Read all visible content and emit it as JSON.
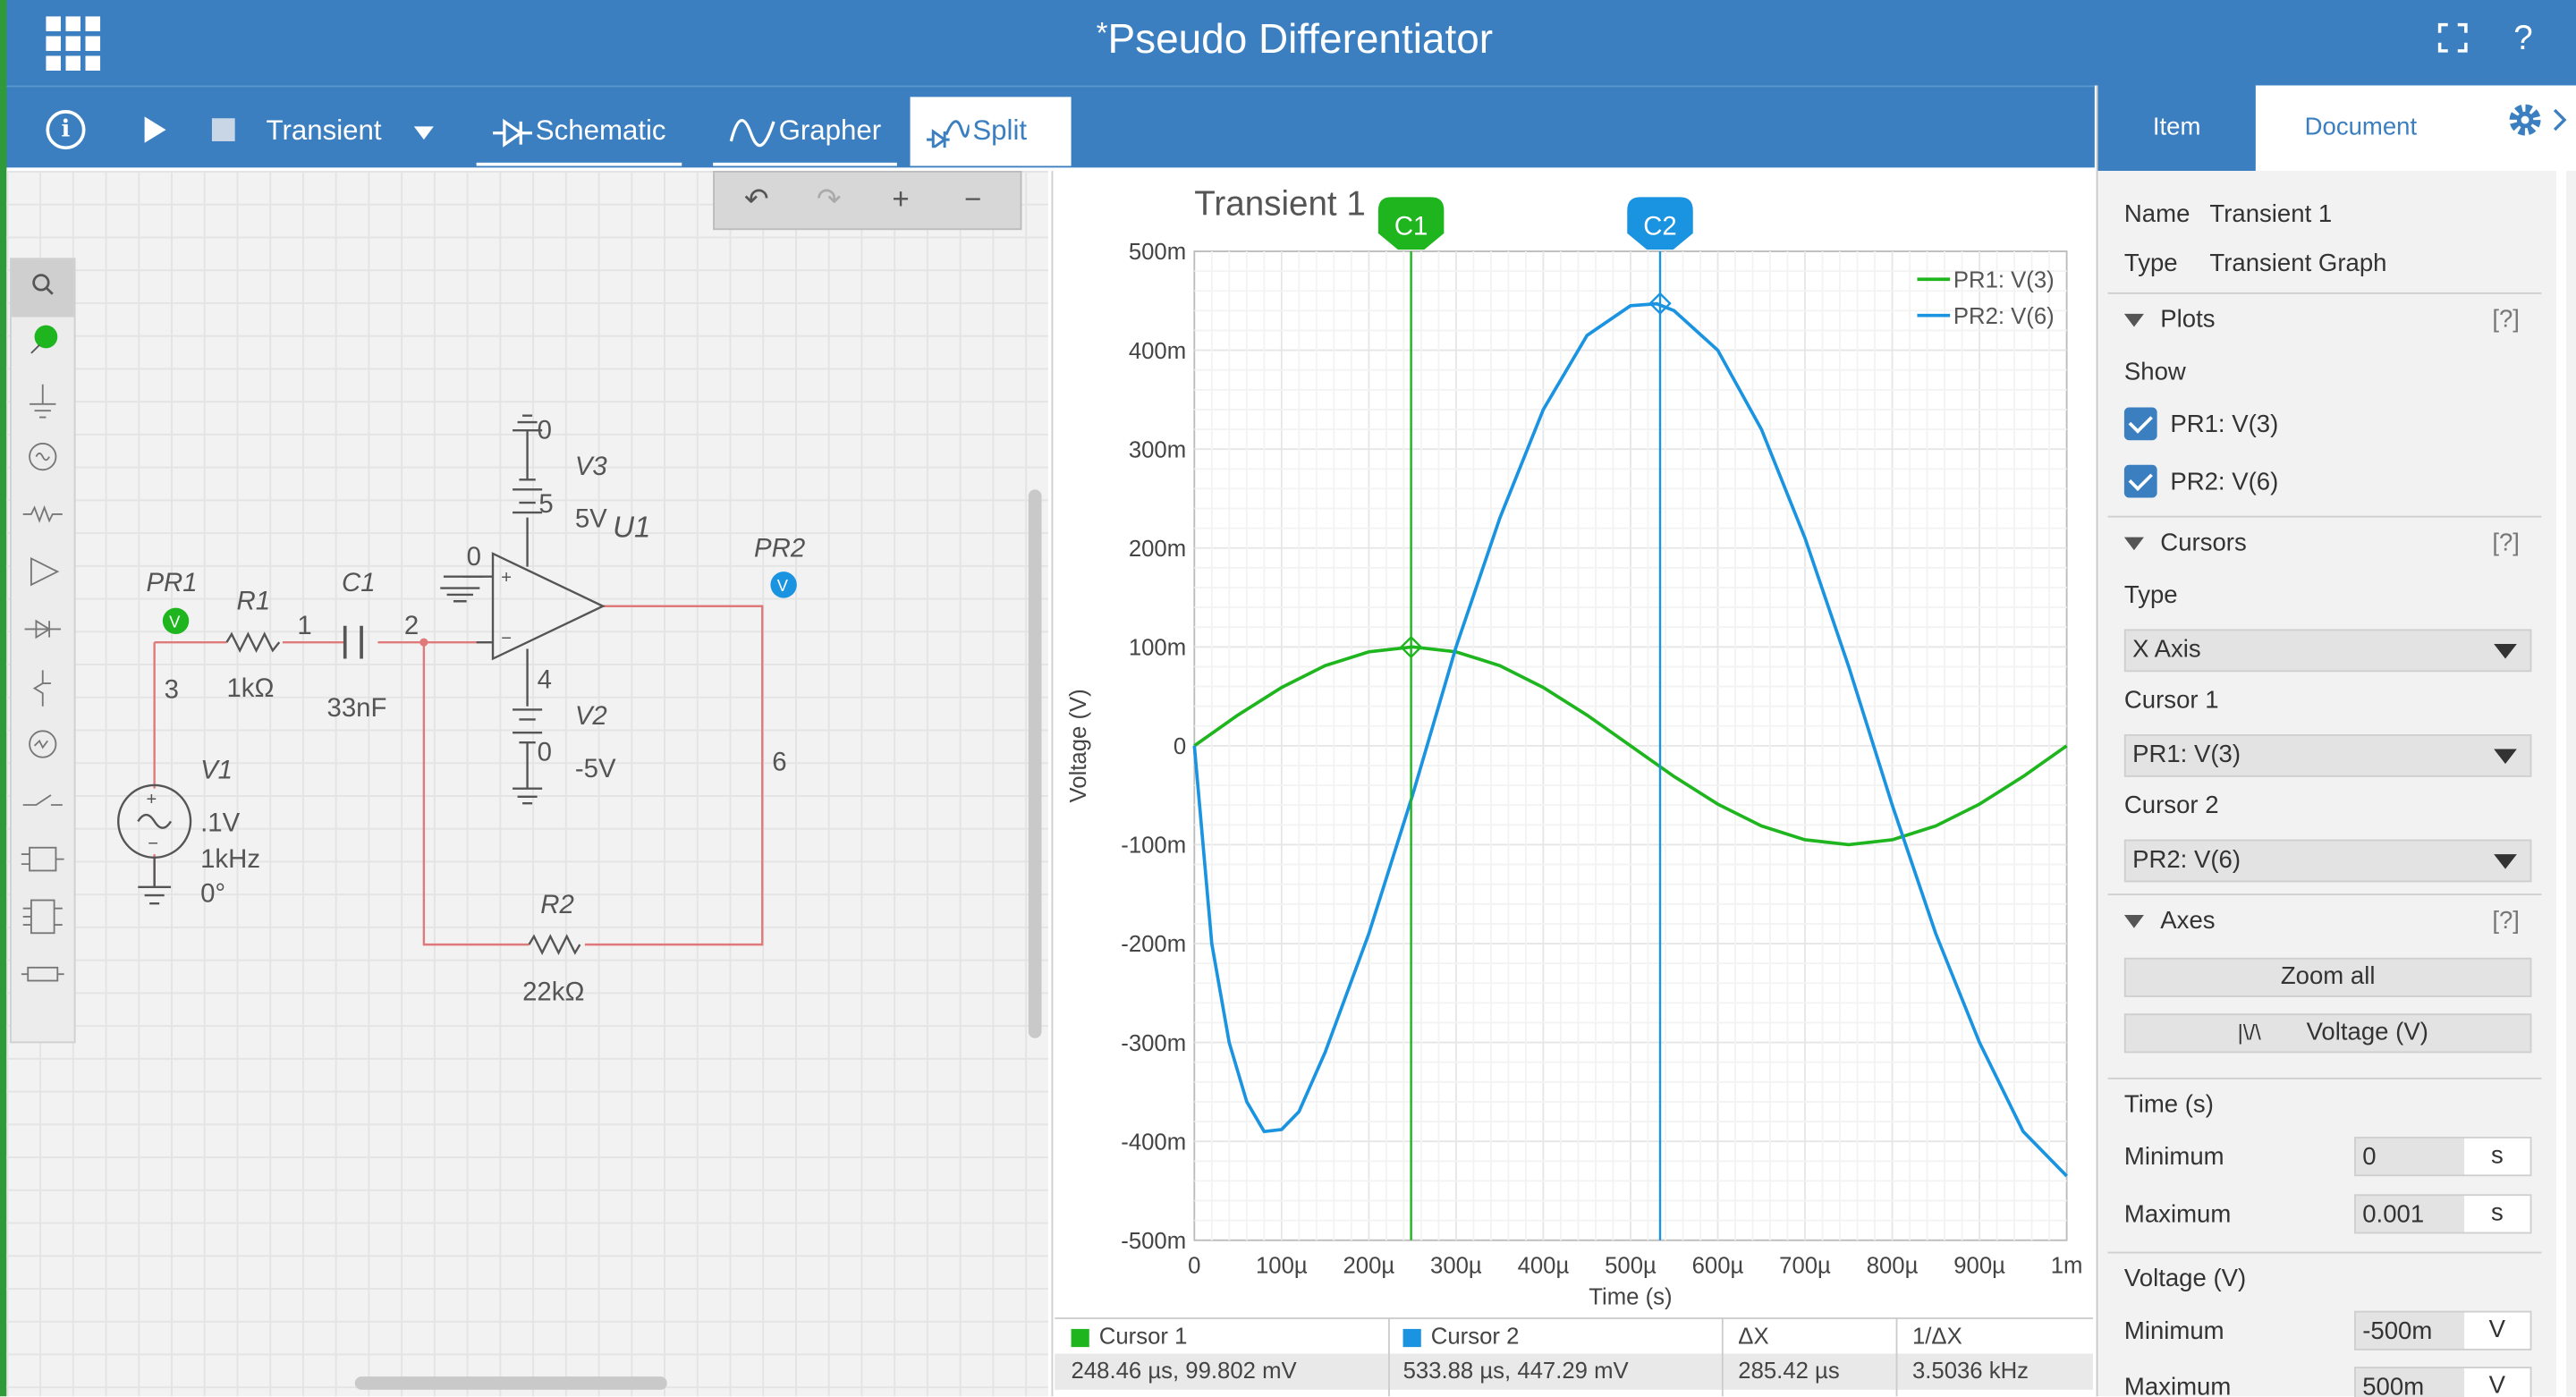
{
  "app": {
    "title": "Pseudo Differentiator",
    "modified_mark": "*"
  },
  "toolbar": {
    "info_label": "i",
    "simulation_type": "Transient",
    "tabs": [
      {
        "label": "Schematic"
      },
      {
        "label": "Grapher"
      },
      {
        "label": "Split"
      }
    ]
  },
  "right_tabs": {
    "item": "Item",
    "document": "Document"
  },
  "schematic": {
    "labels": {
      "pr1": "PR1",
      "r1": "R1",
      "c1": "C1",
      "node1": "1",
      "node2": "2",
      "node3": "3",
      "r1_val": "1kΩ",
      "c1_val": "33nF",
      "v1": "V1",
      "v1_amp": ".1V",
      "v1_freq": "1kHz",
      "v1_phase": "0°",
      "v3": "V3",
      "v3_val": "5V",
      "u1": "U1",
      "node0a": "0",
      "node5": "5",
      "node0b": "0",
      "node4": "4",
      "v2": "V2",
      "v2_val": "-5V",
      "node0c": "0",
      "pr2": "PR2",
      "node6": "6",
      "r2": "R2",
      "r2_val": "22kΩ",
      "probe": "V"
    }
  },
  "graph": {
    "title": "Transient 1",
    "cursor1_tag": "C1",
    "cursor2_tag": "C2",
    "legend": [
      "PR1: V(3)",
      "PR2: V(6)"
    ],
    "ylabel": "Voltage (V)",
    "xlabel": "Time (s)",
    "yticks": [
      "500m",
      "400m",
      "300m",
      "200m",
      "100m",
      "0",
      "-100m",
      "-200m",
      "-300m",
      "-400m",
      "-500m"
    ],
    "xticks": [
      "0",
      "100µ",
      "200µ",
      "300µ",
      "400µ",
      "500µ",
      "600µ",
      "700µ",
      "800µ",
      "900µ",
      "1m"
    ]
  },
  "chart_data": {
    "type": "line",
    "title": "Transient 1",
    "xlabel": "Time (s)",
    "ylabel": "Voltage (V)",
    "xlim": [
      0,
      0.001
    ],
    "ylim": [
      -0.5,
      0.5
    ],
    "grid": true,
    "legend_position": "top-right",
    "series": [
      {
        "name": "PR1: V(3)",
        "color": "#1eb51e",
        "x": [
          0,
          5e-05,
          0.0001,
          0.00015,
          0.0002,
          0.00025,
          0.0003,
          0.00035,
          0.0004,
          0.00045,
          0.0005,
          0.00055,
          0.0006,
          0.00065,
          0.0007,
          0.00075,
          0.0008,
          0.00085,
          0.0009,
          0.00095,
          0.001
        ],
        "y": [
          0,
          0.031,
          0.059,
          0.081,
          0.095,
          0.1,
          0.095,
          0.081,
          0.059,
          0.031,
          0,
          -0.031,
          -0.059,
          -0.081,
          -0.095,
          -0.1,
          -0.095,
          -0.081,
          -0.059,
          -0.031,
          0
        ]
      },
      {
        "name": "PR2: V(6)",
        "color": "#1a93e0",
        "x": [
          0,
          2e-05,
          4e-05,
          6e-05,
          8e-05,
          0.0001,
          0.00012,
          0.00015,
          0.0002,
          0.00025,
          0.0003,
          0.00035,
          0.0004,
          0.00045,
          0.0005,
          0.00053,
          0.00055,
          0.0006,
          0.00065,
          0.0007,
          0.00075,
          0.0008,
          0.00085,
          0.0009,
          0.00095,
          0.001
        ],
        "y": [
          0,
          -0.2,
          -0.3,
          -0.36,
          -0.39,
          -0.388,
          -0.37,
          -0.31,
          -0.19,
          -0.05,
          0.1,
          0.23,
          0.34,
          0.415,
          0.445,
          0.447,
          0.44,
          0.4,
          0.32,
          0.21,
          0.08,
          -0.06,
          -0.19,
          -0.3,
          -0.39,
          -0.435
        ]
      }
    ],
    "cursors": [
      {
        "name": "C1",
        "x": 0.00024846,
        "color": "#1eb51e"
      },
      {
        "name": "C2",
        "x": 0.00053388,
        "color": "#1a93e0"
      }
    ]
  },
  "cursor_table": {
    "headers": [
      "Cursor 1",
      "Cursor 2",
      "ΔX",
      "1/ΔX"
    ],
    "values": [
      "248.46 µs, 99.802 mV",
      "533.88 µs, 447.29 mV",
      "285.42 µs",
      "3.5036 kHz"
    ],
    "colors": [
      "#1eb51e",
      "#1a93e0"
    ]
  },
  "panel": {
    "name_label": "Name",
    "name_value": "Transient 1",
    "type_label": "Type",
    "type_value": "Transient Graph",
    "plots_header": "Plots",
    "help": "[?]",
    "show_label": "Show",
    "plot1": "PR1: V(3)",
    "plot2": "PR2: V(6)",
    "cursors_header": "Cursors",
    "cursor_type_label": "Type",
    "cursor_type_value": "X Axis",
    "cursor1_label": "Cursor 1",
    "cursor1_value": "PR1: V(3)",
    "cursor2_label": "Cursor 2",
    "cursor2_value": "PR2: V(6)",
    "axes_header": "Axes",
    "zoom_all": "Zoom all",
    "voltage_axis_btn": "Voltage (V)",
    "time_header": "Time (s)",
    "time_min_label": "Minimum",
    "time_min_value": "0",
    "time_unit": "s",
    "time_max_label": "Maximum",
    "time_max_value": "0.001",
    "voltage_header": "Voltage (V)",
    "volt_min_label": "Minimum",
    "volt_min_value": "-500m",
    "volt_unit": "V",
    "volt_max_label": "Maximum",
    "volt_max_value": "500m"
  }
}
